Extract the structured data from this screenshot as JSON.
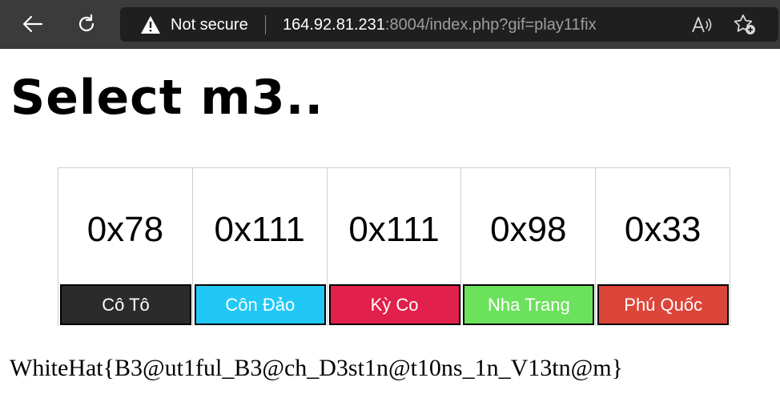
{
  "browser": {
    "not_secure_label": "Not secure",
    "url_host": "164.92.81.231",
    "url_rest": ":8004/index.php?gif=play11fix",
    "icons": {
      "back": "back-arrow-icon",
      "reload": "reload-icon",
      "warning": "warning-icon",
      "read_aloud": "read-aloud-icon",
      "favorite": "add-favorite-icon"
    }
  },
  "page": {
    "title": "Select m3..",
    "options": [
      {
        "code": "0x78",
        "label": "Cô Tô",
        "color": "#2b2b2b",
        "text_color": "#ffffff"
      },
      {
        "code": "0x111",
        "label": "Côn Đảo",
        "color": "#21c8f6",
        "text_color": "#ffffff"
      },
      {
        "code": "0x111",
        "label": "Kỳ Co",
        "color": "#e1204b",
        "text_color": "#ffffff"
      },
      {
        "code": "0x98",
        "label": "Nha Trang",
        "color": "#6ce15c",
        "text_color": "#ffffff"
      },
      {
        "code": "0x33",
        "label": "Phú Quốc",
        "color": "#dc4539",
        "text_color": "#ffffff"
      }
    ],
    "flag": "WhiteHat{B3@ut1ful_B3@ch_D3st1n@t10ns_1n_V13tn@m}"
  }
}
